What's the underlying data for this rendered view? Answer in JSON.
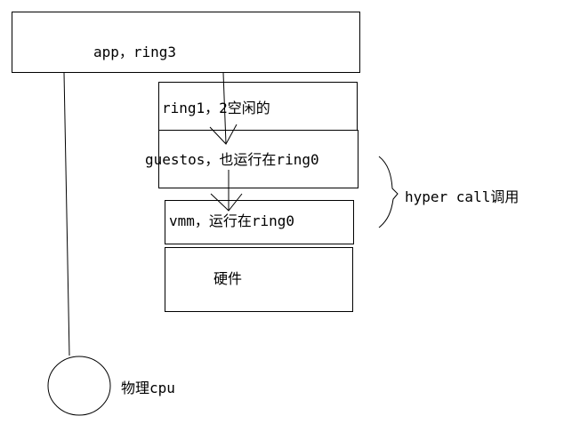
{
  "diagram": {
    "app_label": "app，ring3",
    "ring12_label": "ring1，2空闲的",
    "guestos_label": "guestos，也运行在ring0",
    "vmm_label": "vmm，运行在ring0",
    "hardware_label": "硬件",
    "hypercall_label": "hyper call调用",
    "cpu_label": "物理cpu"
  }
}
